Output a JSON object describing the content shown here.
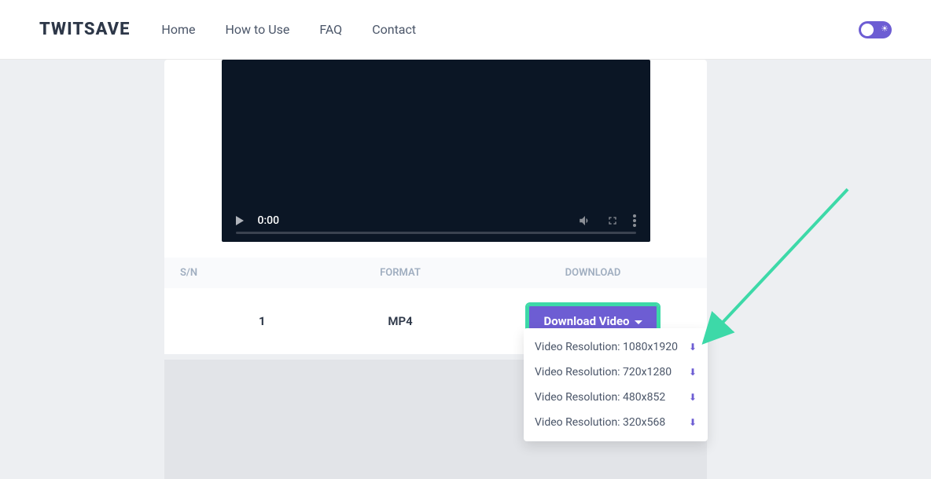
{
  "logo": "TWITSAVE",
  "nav": {
    "home": "Home",
    "howto": "How to Use",
    "faq": "FAQ",
    "contact": "Contact"
  },
  "video": {
    "time": "0:00"
  },
  "table": {
    "headers": {
      "sn": "S/N",
      "format": "FORMAT",
      "download": "DOWNLOAD"
    },
    "row": {
      "sn": "1",
      "format": "MP4",
      "button": "Download Video"
    }
  },
  "dropdown": {
    "item1": "Video Resolution: 1080x1920",
    "item2": "Video Resolution: 720x1280",
    "item3": "Video Resolution: 480x852",
    "item4": "Video Resolution: 320x568"
  }
}
